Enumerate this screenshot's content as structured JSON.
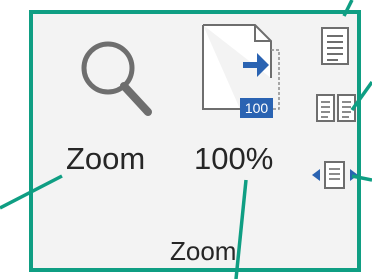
{
  "zoom_group": {
    "title": "Zoom",
    "zoom_button": {
      "label": "Zoom",
      "icon": "magnifier-icon"
    },
    "hundred_percent_button": {
      "label": "100%",
      "icon": "page-100-percent-icon",
      "badge": "100"
    },
    "one_page_button": {
      "icon": "one-page-icon"
    },
    "multiple_pages_button": {
      "icon": "multiple-pages-icon"
    },
    "page_width_button": {
      "icon": "page-width-icon"
    }
  },
  "colors": {
    "group_border": "#0f9e83",
    "callout_line": "#0f9e83",
    "ribbon_background": "#f3f3f3",
    "icon_gray": "#6e6e6e",
    "accent_blue": "#2a63b2"
  }
}
